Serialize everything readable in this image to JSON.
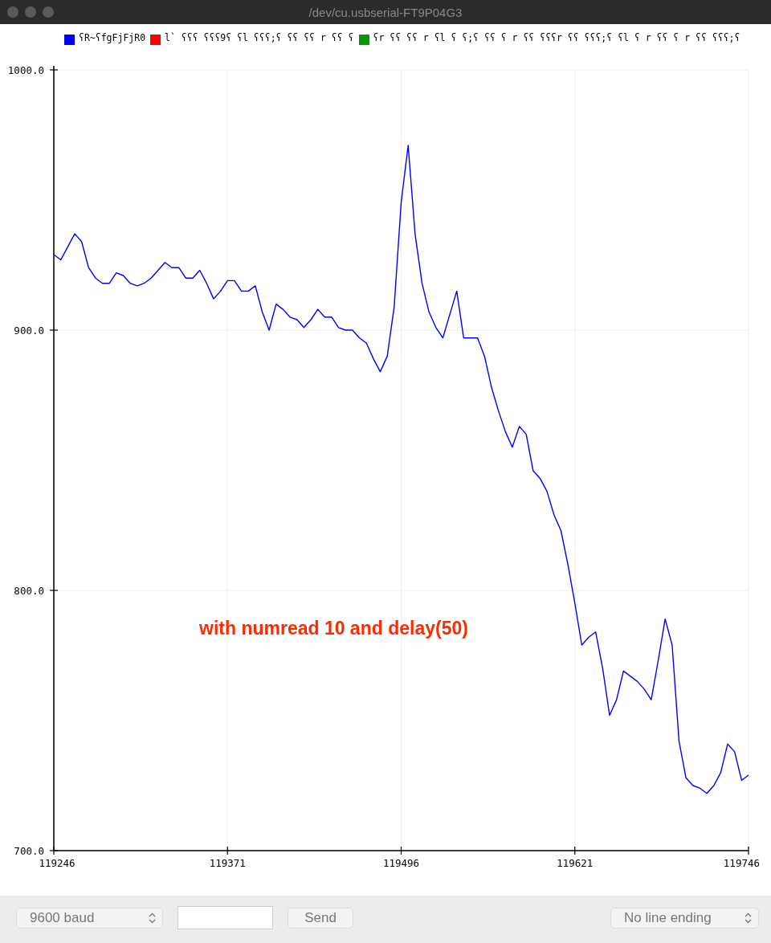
{
  "window": {
    "title": "/dev/cu.usbserial-FT9P04G3"
  },
  "legend": [
    {
      "label": "ʕR~ʕfgFjFjR0",
      "color": "#0000ff"
    },
    {
      "label": "l` ʕʕʕ ʕʕʕ9ʕ ʕl ʕʕʕ;ʕ ʕʕ ʕʕ r ʕʕ ʕ",
      "color": "#ff0000"
    },
    {
      "label": "ʕr ʕʕ ʕʕ r ʕl ʕ ʕ;ʕ ʕʕ ʕ r ʕʕ ʕʕʕr ʕʕ ʕʕʕ;ʕ ʕl ʕ r ʕʕ ʕ r ʕʕ ʕʕʕ;ʕ",
      "color": "#009900"
    }
  ],
  "plot": {
    "chart_data": {
      "type": "line",
      "x": [
        119246,
        119251,
        119256,
        119261,
        119266,
        119271,
        119276,
        119281,
        119286,
        119291,
        119296,
        119301,
        119306,
        119311,
        119316,
        119321,
        119326,
        119331,
        119336,
        119341,
        119346,
        119351,
        119356,
        119361,
        119366,
        119371,
        119376,
        119381,
        119386,
        119391,
        119396,
        119401,
        119406,
        119411,
        119416,
        119421,
        119426,
        119431,
        119436,
        119441,
        119446,
        119451,
        119456,
        119461,
        119466,
        119471,
        119476,
        119481,
        119486,
        119491,
        119496,
        119501,
        119506,
        119511,
        119516,
        119521,
        119526,
        119531,
        119536,
        119541,
        119546,
        119551,
        119556,
        119561,
        119566,
        119571,
        119576,
        119581,
        119586,
        119591,
        119596,
        119601,
        119606,
        119611,
        119616,
        119621,
        119626,
        119631,
        119636,
        119641,
        119646,
        119651,
        119656,
        119661,
        119666,
        119671,
        119676,
        119681,
        119686,
        119691,
        119696,
        119701,
        119706,
        119711,
        119716,
        119721,
        119726,
        119731,
        119736,
        119741,
        119746
      ],
      "grid": true,
      "series": [
        {
          "color": "#0000ff",
          "values": [
            929,
            927,
            932,
            937,
            934,
            924,
            920,
            918,
            918,
            922,
            921,
            918,
            917,
            918,
            920,
            923,
            926,
            924,
            924,
            920,
            920,
            923,
            918,
            912,
            915,
            919,
            919,
            915,
            915,
            917,
            907,
            900,
            910,
            908,
            905,
            904,
            901,
            904,
            908,
            905,
            905,
            901,
            900,
            900,
            897,
            895,
            889,
            884,
            890,
            909,
            949,
            971,
            937,
            918,
            907,
            901,
            897,
            906,
            915,
            897,
            897,
            897,
            890,
            878,
            869,
            861,
            855,
            863,
            860,
            846,
            843,
            838,
            829,
            823,
            810,
            795,
            779,
            782,
            784,
            770,
            752,
            758,
            769,
            767,
            765,
            762,
            758,
            773,
            789,
            779,
            742,
            728,
            725,
            724,
            722,
            725,
            730,
            741,
            738,
            727,
            729
          ]
        }
      ],
      "xlim": [
        119246,
        119746
      ],
      "ylim": [
        700,
        1000
      ],
      "xticks": [
        119246,
        119371,
        119496,
        119621,
        119746
      ],
      "yticks": [
        {
          "value": 700,
          "label": "700.0"
        },
        {
          "value": 800,
          "label": "800.0"
        },
        {
          "value": 900,
          "label": "900.0"
        },
        {
          "value": 1000,
          "label": "1000.0"
        }
      ],
      "annotations": [
        "with numread 10 and delay(50)"
      ]
    }
  },
  "controls": {
    "baud": "9600 baud",
    "send": "Send",
    "line_ending": "No line ending"
  }
}
